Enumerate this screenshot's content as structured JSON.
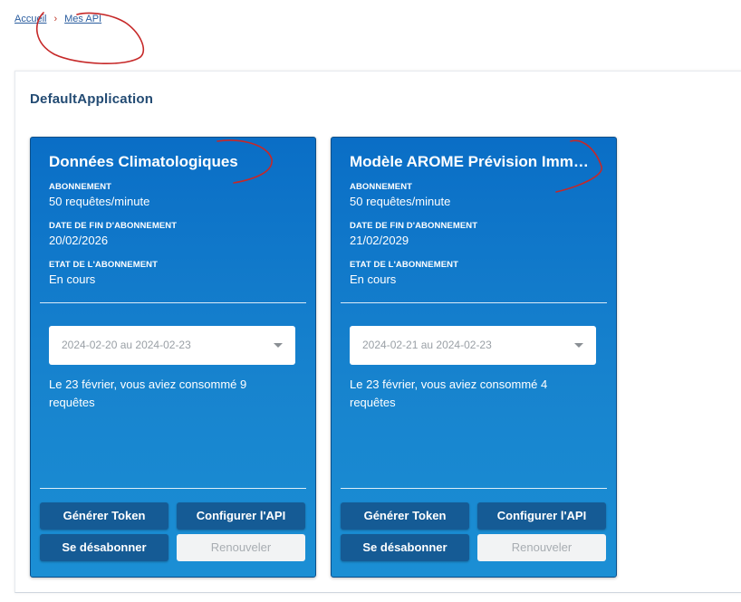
{
  "breadcrumb": {
    "home": "Accueil",
    "separator": "›",
    "current": "Mes API"
  },
  "application": {
    "title": "DefaultApplication"
  },
  "cards": [
    {
      "title": "Données Climatologiques",
      "subscription_label": "ABONNEMENT",
      "subscription_value": "50 requêtes/minute",
      "end_date_label": "DATE DE FIN D'ABONNEMENT",
      "end_date_value": "20/02/2026",
      "status_label": "ETAT DE L'ABONNEMENT",
      "status_value": "En cours",
      "date_range": "2024-02-20 au 2024-02-23",
      "consumption": "Le 23 février, vous aviez consommé 9 requêtes",
      "btn_token": "Générer Token",
      "btn_config": "Configurer l'API",
      "btn_unsubscribe": "Se désabonner",
      "btn_renew": "Renouveler"
    },
    {
      "title": "Modèle AROME Prévision Imm…",
      "subscription_label": "ABONNEMENT",
      "subscription_value": "50 requêtes/minute",
      "end_date_label": "DATE DE FIN D'ABONNEMENT",
      "end_date_value": "21/02/2029",
      "status_label": "ETAT DE L'ABONNEMENT",
      "status_value": "En cours",
      "date_range": "2024-02-21 au 2024-02-23",
      "consumption": "Le 23 février, vous aviez consommé 4 requêtes",
      "btn_token": "Générer Token",
      "btn_config": "Configurer l'API",
      "btn_unsubscribe": "Se désabonner",
      "btn_renew": "Renouveler"
    }
  ],
  "colors": {
    "card_top": "#0a6ec6",
    "card_bottom": "#1b8fd4",
    "button_dark": "#155b95",
    "annotation_red": "#c62828"
  }
}
